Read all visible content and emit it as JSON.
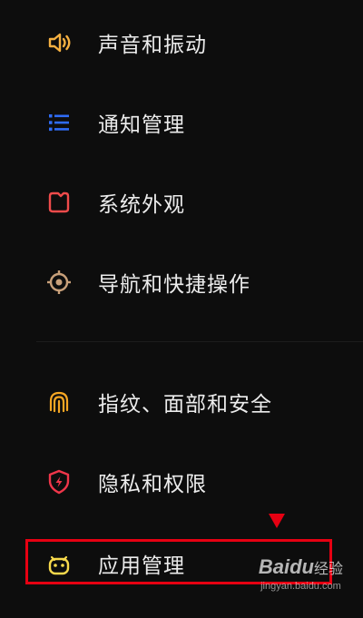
{
  "menu": {
    "items": [
      {
        "label": "声音和振动",
        "icon": "speaker-icon",
        "color": "#f5b041"
      },
      {
        "label": "通知管理",
        "icon": "list-icon",
        "color": "#2f6cf6"
      },
      {
        "label": "系统外观",
        "icon": "appearance-icon",
        "color": "#ef4b4b"
      },
      {
        "label": "导航和快捷操作",
        "icon": "target-icon",
        "color": "#c8a07a"
      },
      {
        "label": "指纹、面部和安全",
        "icon": "fingerprint-icon",
        "color": "#f5a623"
      },
      {
        "label": "隐私和权限",
        "icon": "shield-icon",
        "color": "#f0364a"
      },
      {
        "label": "应用管理",
        "icon": "android-icon",
        "color": "#f7d94c"
      }
    ]
  },
  "annotation": {
    "highlight_color": "#e60012"
  },
  "watermark": {
    "logo": "Baidu",
    "suffix": "经验",
    "url": "jingyan.baidu.com"
  }
}
